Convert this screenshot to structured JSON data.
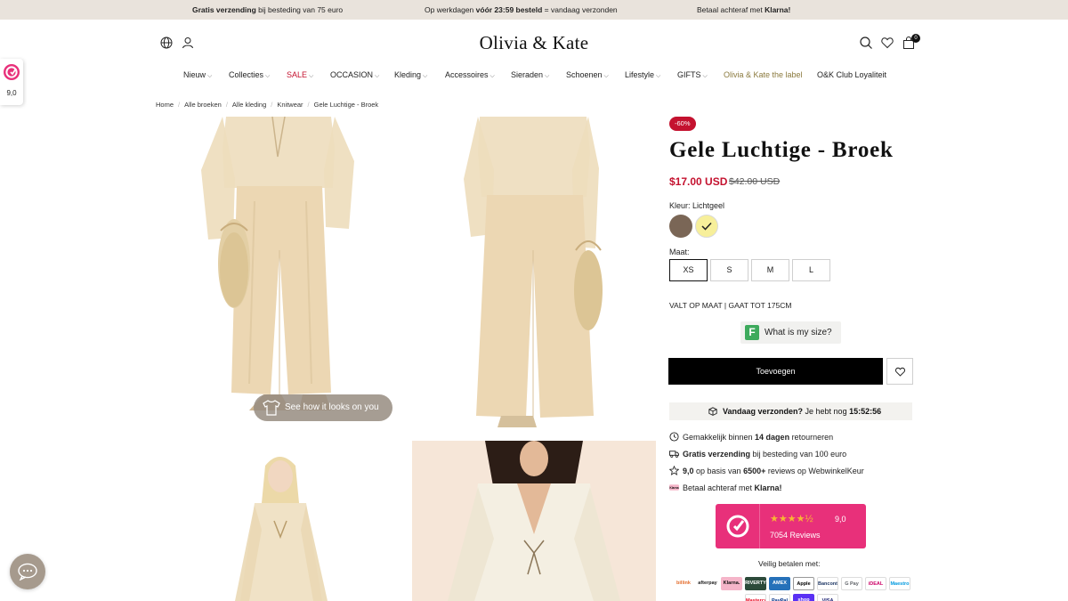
{
  "announcement": {
    "left_bold": "Gratis verzending",
    "left_rest": " bij besteding van 75 euro",
    "mid_pre": "Op werkdagen ",
    "mid_bold": "vóór 23:59 besteld",
    "mid_post": " = vandaag verzonden",
    "right_pre": "Betaal achteraf met ",
    "right_bold": "Klarna!"
  },
  "header": {
    "logo": "Olivia & Kate",
    "icons": [
      "globe-icon",
      "account-icon",
      "search-icon",
      "heart-icon",
      "bag-icon"
    ],
    "cart_count": "0"
  },
  "nav": {
    "items": [
      {
        "label": "Nieuw",
        "chevron": true
      },
      {
        "label": "Collecties",
        "chevron": true
      },
      {
        "label": "SALE",
        "chevron": true
      },
      {
        "label": "OCCASION",
        "chevron": true
      },
      {
        "label": "Kleding",
        "chevron": true
      },
      {
        "label": "Accessoires",
        "chevron": true
      },
      {
        "label": "Sieraden",
        "chevron": true
      },
      {
        "label": "Schoenen",
        "chevron": true
      },
      {
        "label": "Lifestyle",
        "chevron": true
      },
      {
        "label": "GIFTS",
        "chevron": true
      },
      {
        "label": "Olivia & Kate the label",
        "chevron": false
      },
      {
        "label": "O&K Club Loyaliteit",
        "chevron": false
      }
    ],
    "chevron_glyph": "⌵"
  },
  "side_widget": {
    "score": "9,0"
  },
  "breadcrumb": [
    "Home",
    "Alle broeken",
    "Alle kleding",
    "Knitwear",
    "Gele Luchtige - Broek"
  ],
  "gallery": {
    "tryon_label": "See how it looks on you"
  },
  "product": {
    "badge": "-60%",
    "title": "Gele Luchtige - Broek",
    "price": "$17.00 USD",
    "old_price": "$42.00 USD",
    "color_label": "Kleur: Lichtgeel",
    "swatches": [
      {
        "name": "brown",
        "color": "#7a6656",
        "selected": false
      },
      {
        "name": "light-yellow",
        "color": "#f7ef9a",
        "selected": true
      }
    ],
    "size_label": "Maat:",
    "sizes": [
      "XS",
      "S",
      "M",
      "L"
    ],
    "selected_size": "XS",
    "fit_note": "VALT OP MAAT | GAAT TOT 175CM",
    "size_tool": {
      "letter": "F",
      "label": "What is my size?"
    },
    "add_button": "Toevoegen",
    "shipping": {
      "pre": "Vandaag verzonden?",
      "mid": " Je hebt nog ",
      "time": "15:52:56"
    }
  },
  "usps": [
    {
      "icon": "clock-icon",
      "pre": "Gemakkelijk binnen ",
      "bold": "14 dagen",
      "post": " retourneren"
    },
    {
      "icon": "truck-icon",
      "pre": "",
      "bold": "Gratis verzending",
      "post": " bij besteding van 100 euro"
    },
    {
      "icon": "star-icon",
      "pre": "",
      "bold": "9,0",
      "post": " op basis van ",
      "bold2": "6500+",
      "post2": " reviews op WebwinkelKeur"
    },
    {
      "icon": "klarna-icon",
      "pre": "Betaal achteraf met ",
      "bold": "Klarna!",
      "post": ""
    }
  ],
  "reviews": {
    "score": "9,0",
    "count": "7054 Reviews",
    "stars": "★★★★½"
  },
  "payments": {
    "label": "Veilig betalen met:",
    "row1": [
      "billink",
      "afterpay",
      "Klarna.",
      "RIVERTY",
      "AMEX",
      "Apple Pay",
      "Bancontact",
      "G Pay",
      "iDEAL",
      "Maestro"
    ],
    "row2": [
      "Mastercard",
      "PayPal",
      "shop",
      "VISA"
    ]
  },
  "colors": {
    "accent_red": "#c4122f",
    "review_pink": "#e8307a",
    "announce_bg": "#e9e3dc"
  }
}
